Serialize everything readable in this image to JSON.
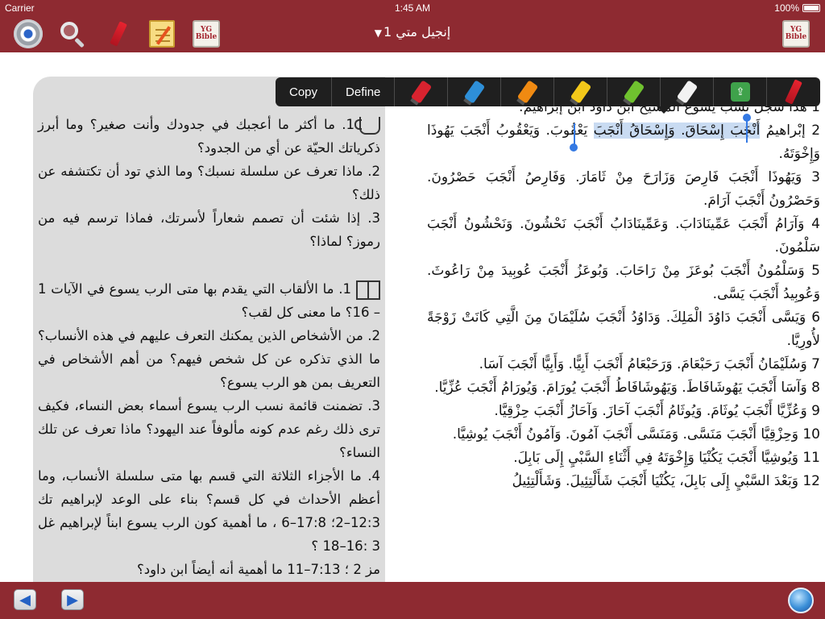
{
  "status": {
    "carrier": "Carrier",
    "time": "1:45 AM",
    "battery": "100%"
  },
  "nav": {
    "title": "إنجيل متي 1",
    "caret": "▼",
    "bible_logo": "YG Bible",
    "icons": [
      "settings-gear-icon",
      "search-icon",
      "highlighter-pen-icon",
      "notes-icon",
      "bible-book-icon"
    ]
  },
  "edit_menu": {
    "copy": "Copy",
    "define": "Define",
    "highlight_colors": [
      "#d8232f",
      "#2e8fd8",
      "#f08a12",
      "#f3c81a",
      "#6fc12f",
      "#f2f2f2"
    ],
    "share_icon": "share-icon"
  },
  "notes_panel": {
    "section1_icon": "cup-icon",
    "section1": [
      "1. ما أكثر ما أعجبك في جدودك وأنت صغير؟ وما أبرز ذكرياتك الحيّة عن أي من الجدود؟",
      "2. ماذا تعرف عن سلسلة نسبك؟ وما الذي تود أن تكتشفه عن ذلك؟",
      "3. إذا شئت أن تصمم شعاراً لأسرتك، فماذا ترسم فيه من رموز؟ لماذا؟"
    ],
    "section2_icon": "open-book-icon",
    "section2": [
      "1. ما الألقاب التي يقدم بها متى الرب يسوع في الآيات 1 – 16؟ ما معنى كل لقب؟",
      "2. من الأشخاص الذين يمكنك التعرف عليهم في هذه الأنساب؟ ما الذي تذكره عن كل شخص فيهم؟ من أهم الأشخاص في التعريف بمن هو الرب يسوع؟",
      "3. تضمنت قائمة نسب الرب يسوع أسماء بعض النساء، فكيف ترى ذلك رغم عدم كونه مألوفاً عند اليهود؟ ماذا تعرف عن تلك النساء؟",
      "4. ما الأجزاء الثلاثة التي قسم بها متى سلسلة الأنساب، وما أعظم الأحداث في كل قسم؟ بناء على الوعد لإبراهيم تك 12:3–2؛ 17:8–6 ، ما أهمية كون الرب يسوع ابناً لإبراهيم غل 3 :16–18 ؟",
      "مز 2 ؛ 7:13–11 ما أهمية أنه أيضاً ابن داود؟"
    ]
  },
  "scripture": {
    "verses": [
      {
        "num": "1",
        "text": "هذا سجل نسب يسوع المسيح ابن داود ابن إبراهيم:"
      },
      {
        "num": "2",
        "pre": "إبْراهيمُ ",
        "selected": "أَنْجَبَ إِسْحَاقَ. وَإِسْحَاقُ أَنْجَبَ",
        "post": " يَعْقُوبَ. وَيَعْقُوبُ أَنْجَبَ يَهُوذَا وَإِخْوَتَهُ."
      },
      {
        "num": "3",
        "text": "وَيَهُوذَا أَنْجَبَ فَارِصَ وَزَارَحَ مِنْ ثَامَارَ. وَفَارِصُ أَنْجَبَ حَصْرُونَ. وَحَصْرُونُ أَنْجَبَ آرَامَ."
      },
      {
        "num": "4",
        "text": "وَآرَامُ أَنْجَبَ عَمِّينَادَابَ. وَعَمِّينَادَابُ أَنْجَبَ نَحْشُونَ. وَنَحْشُونُ أَنْجَبَ سَلْمُونَ."
      },
      {
        "num": "5",
        "text": "وَسَلْمُونُ أَنْجَبَ بُوعَزَ مِنْ رَاحَابَ. وَبُوعَزُ أَنْجَبَ عُوبِيدَ مِنْ رَاعُوثَ. وَعُوبِيدُ أَنْجَبَ يَسَّى."
      },
      {
        "num": "6",
        "text": "وَيَسَّى أَنْجَبَ دَاوُدَ الْمَلِكَ. وَدَاوُدُ أَنْجَبَ سُلَيْمَانَ مِنَ الَّتِي كَانَتْ زَوْجَةً لأُورِيَّا."
      },
      {
        "num": "7",
        "text": "وَسُلَيْمَانُ أَنْجَبَ رَحَبْعَامَ. وَرَحَبْعَامُ أَنْجَبَ أَبِيًّا. وَأَبِيًّا أَنْجَبَ آسَا."
      },
      {
        "num": "8",
        "text": "وَآسَا أَنْجَبَ يَهُوشَافَاطَ. وَيَهُوشَافَاطُ أَنْجَبَ يُورَامَ. وَيُورَامُ أَنْجَبَ عُزِّيَّا."
      },
      {
        "num": "9",
        "text": "وَعُزِّيَّا أَنْجَبَ يُوثَامَ. وَيُوثَامُ أَنْجَبَ آحَازَ. وَآحَازُ أَنْجَبَ حِزْقِيَّا."
      },
      {
        "num": "10",
        "text": "وَحِزْقِيَّا أَنْجَبَ مَنَسَّى. وَمَنَسَّى أَنْجَبَ آمُونَ. وَآمُونُ أَنْجَبَ يُوشِيَّا."
      },
      {
        "num": "11",
        "text": "وَيُوشِيَّا أَنْجَبَ يَكُنْيَا وَإِخْوَتَهُ فِي أَثْنَاءِ السَّبْيِ إِلَى بَابِلَ."
      },
      {
        "num": "12",
        "text": "وَبَعْدَ السَّبْيِ إِلَى بَابِلَ، يَكُنْيَا أَنْجَبَ شَأَلْتِئِيلَ. وَشَأَلْتِئِيلُ"
      }
    ]
  },
  "bottom": {
    "back": "◀",
    "forward": "▶",
    "globe_icon": "globe-icon"
  }
}
